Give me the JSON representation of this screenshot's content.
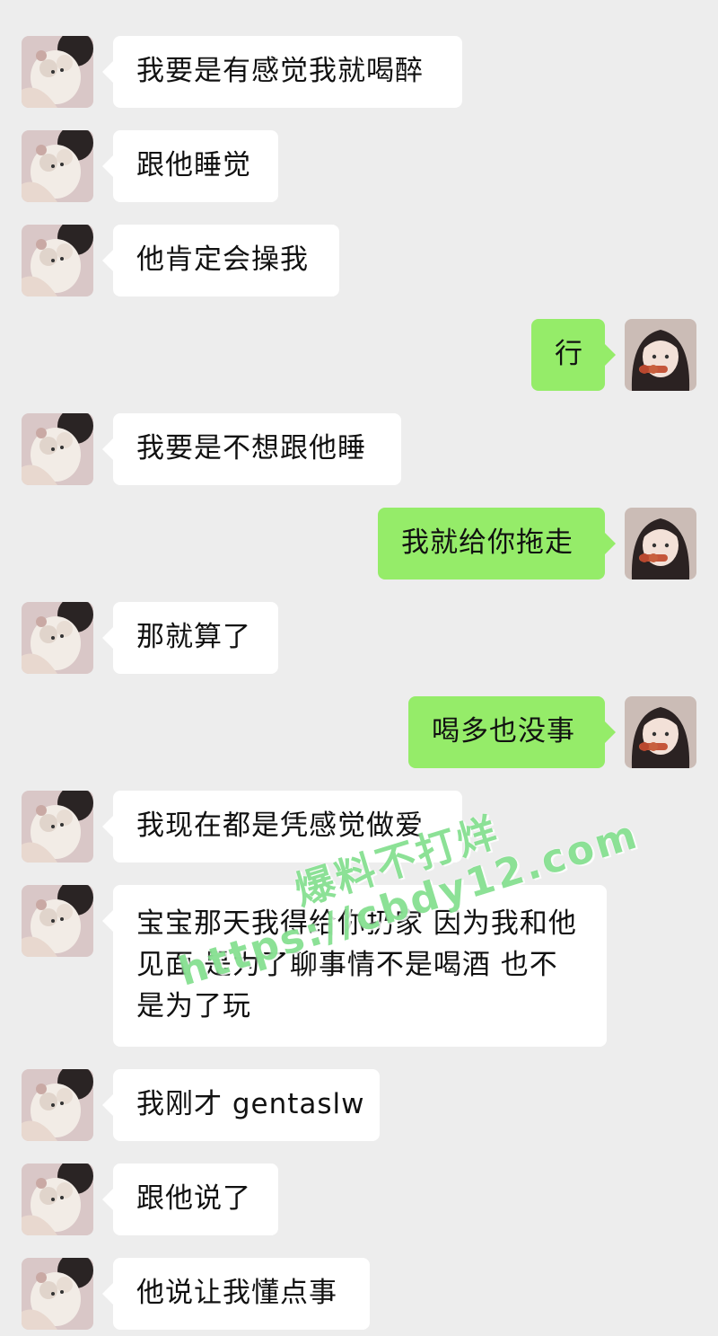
{
  "messages": [
    {
      "side": "left",
      "text": "我要是有感觉我就喝醉"
    },
    {
      "side": "left",
      "text": "跟他睡觉"
    },
    {
      "side": "left",
      "text": "他肯定会操我"
    },
    {
      "side": "right",
      "text": "行"
    },
    {
      "side": "left",
      "text": "我要是不想跟他睡"
    },
    {
      "side": "right",
      "text": "我就给你拖走"
    },
    {
      "side": "left",
      "text": "那就算了"
    },
    {
      "side": "right",
      "text": "喝多也没事"
    },
    {
      "side": "left",
      "text": "我现在都是凭感觉做爱"
    },
    {
      "side": "left",
      "text": "宝宝那天我得给你扔家 因为我和他见面 是为了聊事情不是喝酒 也不是为了玩"
    },
    {
      "side": "left",
      "text": "我刚才 gentaslw"
    },
    {
      "side": "left",
      "text": "跟他说了"
    },
    {
      "side": "left",
      "text": "他说让我懂点事"
    }
  ],
  "watermark": {
    "line1": "爆料不打烊",
    "line2": "https://cbdy12.com"
  },
  "colors": {
    "background": "#ededed",
    "incoming_bubble": "#ffffff",
    "outgoing_bubble": "#95ec69"
  },
  "icons": {
    "incoming_avatar": "plush-toy-avatar",
    "outgoing_avatar": "girl-photo-avatar"
  }
}
